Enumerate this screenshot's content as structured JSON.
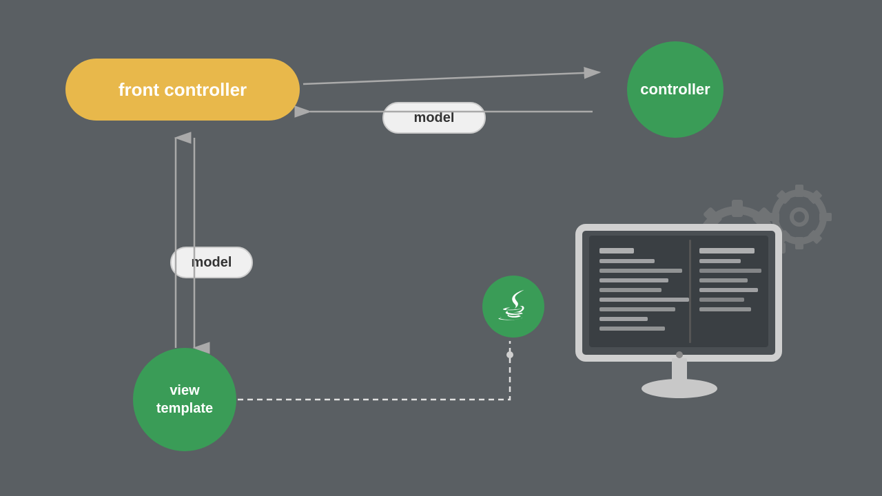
{
  "diagram": {
    "background_color": "#5a5f63",
    "front_controller": {
      "label": "front controller",
      "color": "#e8b84b",
      "text_color": "#ffffff"
    },
    "controller": {
      "label": "controller",
      "color": "#3a9c57",
      "text_color": "#ffffff"
    },
    "view_template": {
      "label": "view\ntemplate",
      "color": "#3a9c57",
      "text_color": "#ffffff"
    },
    "model_horizontal": {
      "label": "model"
    },
    "model_vertical": {
      "label": "model"
    },
    "arrow_color": "#aaaaaa",
    "gear_color": "#888888"
  }
}
